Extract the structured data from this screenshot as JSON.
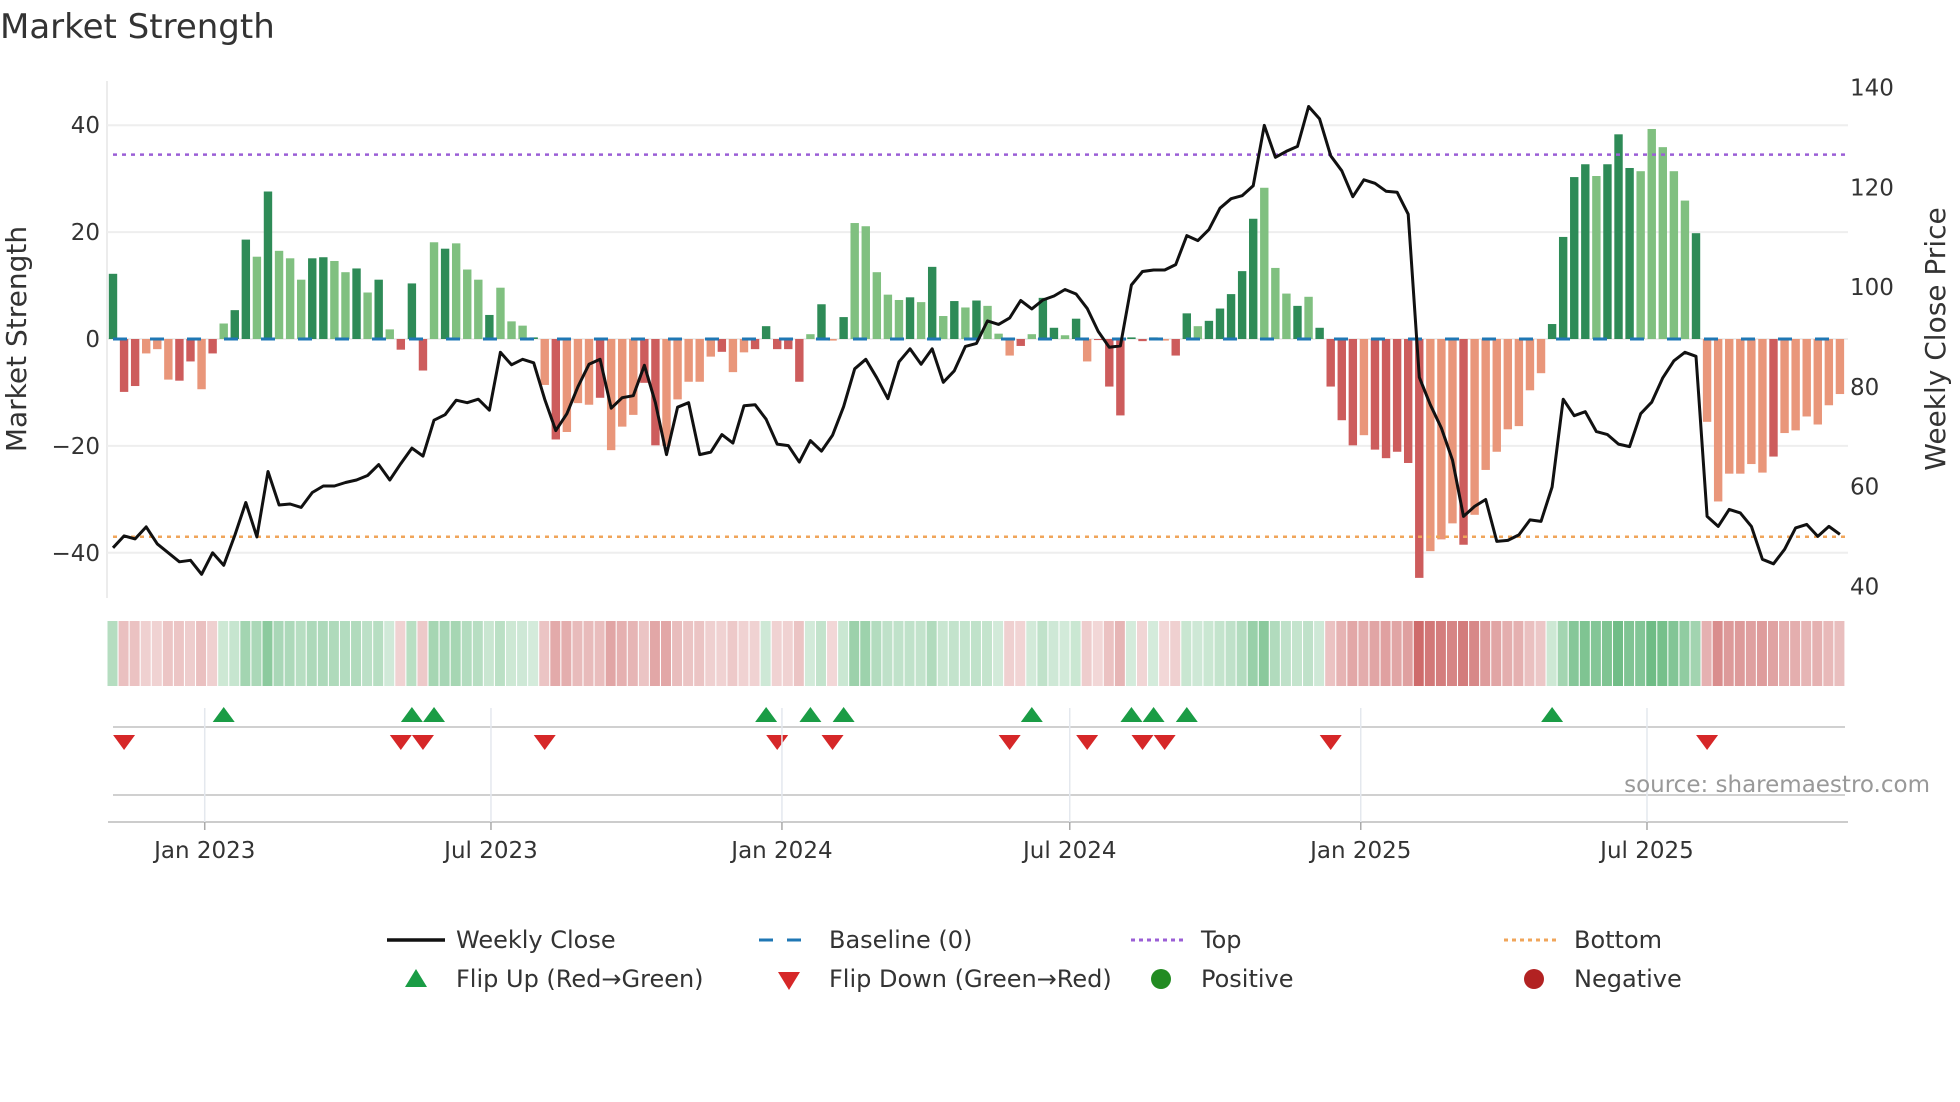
{
  "chart_data": {
    "type": "bar",
    "title": "Market Strength",
    "ylabel": "Market Strength",
    "y2label": "Weekly Close Price",
    "ylim": [
      -48,
      48
    ],
    "y2lim": [
      38,
      142
    ],
    "yticks": [
      40,
      20,
      0,
      -20,
      -40
    ],
    "y2ticks": [
      140,
      120,
      100,
      80,
      60,
      40
    ],
    "start_date": "2022-11-04",
    "xticks": [
      {
        "date": "2023-01-01",
        "label": "Jan 2023"
      },
      {
        "date": "2023-07-01",
        "label": "Jul 2023"
      },
      {
        "date": "2024-01-01",
        "label": "Jan 2024"
      },
      {
        "date": "2024-07-01",
        "label": "Jul 2024"
      },
      {
        "date": "2025-01-01",
        "label": "Jan 2025"
      },
      {
        "date": "2025-07-01",
        "label": "Jul 2025"
      }
    ],
    "top_level": 34.5,
    "bottom_level": -37,
    "baseline": 0,
    "strength": [
      12.2,
      -9.9,
      -8.8,
      -2.7,
      -1.9,
      -7.6,
      -7.8,
      -4.2,
      -9.4,
      -2.7,
      2.9,
      5.4,
      18.6,
      15.4,
      27.6,
      16.5,
      15.1,
      11.1,
      15.1,
      15.3,
      14.6,
      12.5,
      13.2,
      8.7,
      11.1,
      1.8,
      -2.0,
      10.4,
      -5.9,
      18.1,
      16.9,
      17.9,
      13.0,
      11.1,
      4.5,
      9.6,
      3.3,
      2.5,
      0.3,
      -8.6,
      -18.8,
      -17.4,
      -12.0,
      -12.3,
      -11.0,
      -20.8,
      -16.4,
      -14.2,
      -8.2,
      -19.9,
      -20.0,
      -11.3,
      -8,
      -8,
      -3.3,
      -2.4,
      -6.2,
      -2.5,
      -1.9,
      2.4,
      -1.9,
      -1.9,
      -8,
      0.9,
      6.5,
      -0.3,
      4.1,
      21.7,
      21.1,
      12.5,
      8.3,
      7.3,
      7.8,
      6.9,
      13.5,
      4.3,
      7.1,
      5.9,
      7.2,
      6.2,
      1.0,
      -3.1,
      -1.3,
      0.9,
      7.7,
      2.1,
      0.7,
      3.8,
      -4.2,
      -0.2,
      -8.9,
      -14.3,
      0.3,
      -0.4,
      0.3,
      -0.3,
      -3.1,
      4.8,
      2.4,
      3.4,
      5.7,
      8.4,
      12.7,
      22.5,
      28.3,
      13.3,
      8.5,
      6.2,
      7.9,
      2.1,
      -8.9,
      -15.2,
      -19.9,
      -18,
      -20.7,
      -22.3,
      -21.1,
      -23.2,
      -44.7,
      -39.7,
      -37.5,
      -34.5,
      -38.5,
      -32.9,
      -24.5,
      -21.1,
      -16.9,
      -16.3,
      -9.6,
      -6.4,
      2.8,
      19.1,
      30.3,
      32.7,
      30.5,
      32.7,
      38.3,
      32,
      31.4,
      39.3,
      35.9,
      31.4,
      25.9,
      19.8,
      -15.5,
      -30.4,
      -25.2,
      -25.2,
      -23.4,
      -25,
      -22,
      -17.6,
      -17.1,
      -14.5,
      -16,
      -12.4,
      -10.3
    ],
    "shade": "dddlllddldlddldlllddlldldldddldllldllldldllldlllddllllldlldddddldldllllldldldldllldlddldlddddddlddldddddllldlddddldddddllldlllllllddddldddllllldlllllldll",
    "weekly_close": [
      47.7,
      50.1,
      49.5,
      51.9,
      48.5,
      46.7,
      44.9,
      45.2,
      42.4,
      46.7,
      44.2,
      50.2,
      56.8,
      49.9,
      63,
      56.3,
      56.5,
      55.8,
      58.8,
      60.1,
      60.1,
      60.8,
      61.3,
      62.2,
      64.4,
      61.3,
      64.6,
      67.7,
      66.1,
      73.3,
      74.4,
      77.3,
      76.8,
      77.5,
      75.3,
      86.9,
      84.4,
      85.5,
      84.8,
      77.5,
      71.2,
      74.6,
      80,
      84.5,
      85.5,
      75.7,
      77.8,
      78.2,
      84.3,
      76.8,
      66.4,
      75.9,
      76.8,
      66.4,
      66.9,
      70.4,
      68.7,
      76.2,
      76.4,
      73.5,
      68.5,
      68.2,
      64.9,
      69.2,
      67.1,
      70.3,
      76,
      83.6,
      85.5,
      81.8,
      77.6,
      85,
      87.6,
      84.5,
      87.6,
      80.9,
      83.2,
      88.1,
      88.7,
      93.2,
      92.5,
      93.8,
      97.3,
      95.6,
      97.4,
      98.2,
      99.5,
      98.6,
      95.7,
      91.1,
      87.9,
      88.2,
      100.4,
      103.1,
      103.4,
      103.4,
      104.5,
      110.3,
      109.3,
      111.5,
      115.8,
      117.7,
      118.3,
      120.3,
      132.4,
      126,
      127.2,
      128.2,
      136.2,
      133.7,
      126.3,
      123.3,
      118.1,
      121.5,
      120.8,
      119.2,
      119,
      114.6,
      81.9,
      76.4,
      71.7,
      65.3,
      54,
      56,
      57.4,
      49,
      49.2,
      50.3,
      53.3,
      53,
      59.9,
      77.5,
      74.2,
      75,
      71,
      70.4,
      68.5,
      68,
      74.6,
      76.9,
      81.8,
      85.2,
      86.9,
      86.1,
      54,
      52,
      55.4,
      54.7,
      52,
      45.4,
      44.5,
      47.4,
      51.7,
      52.4,
      50,
      52,
      50.4
    ],
    "legend": {
      "weekly_close": "Weekly Close",
      "baseline": "Baseline (0)",
      "top": "Top",
      "bottom": "Bottom",
      "flip_up": "Flip Up (Red→Green)",
      "flip_down": "Flip Down (Green→Red)",
      "positive": "Positive",
      "negative": "Negative"
    },
    "legend_placement": "bottom-center",
    "source": "source: sharemaestro.com"
  },
  "colors": {
    "dark_green": "#2e8b57",
    "light_green": "#80c080",
    "dark_red": "#cd5c5c",
    "light_red": "#e9967a",
    "line": "#111111",
    "baseline": "#1f77b4",
    "top": "#9b5fd6",
    "bottom": "#f0a55a",
    "flip_up": "#1a9c45",
    "flip_down": "#d62728",
    "positive": "#228b22",
    "negative": "#b22222"
  }
}
